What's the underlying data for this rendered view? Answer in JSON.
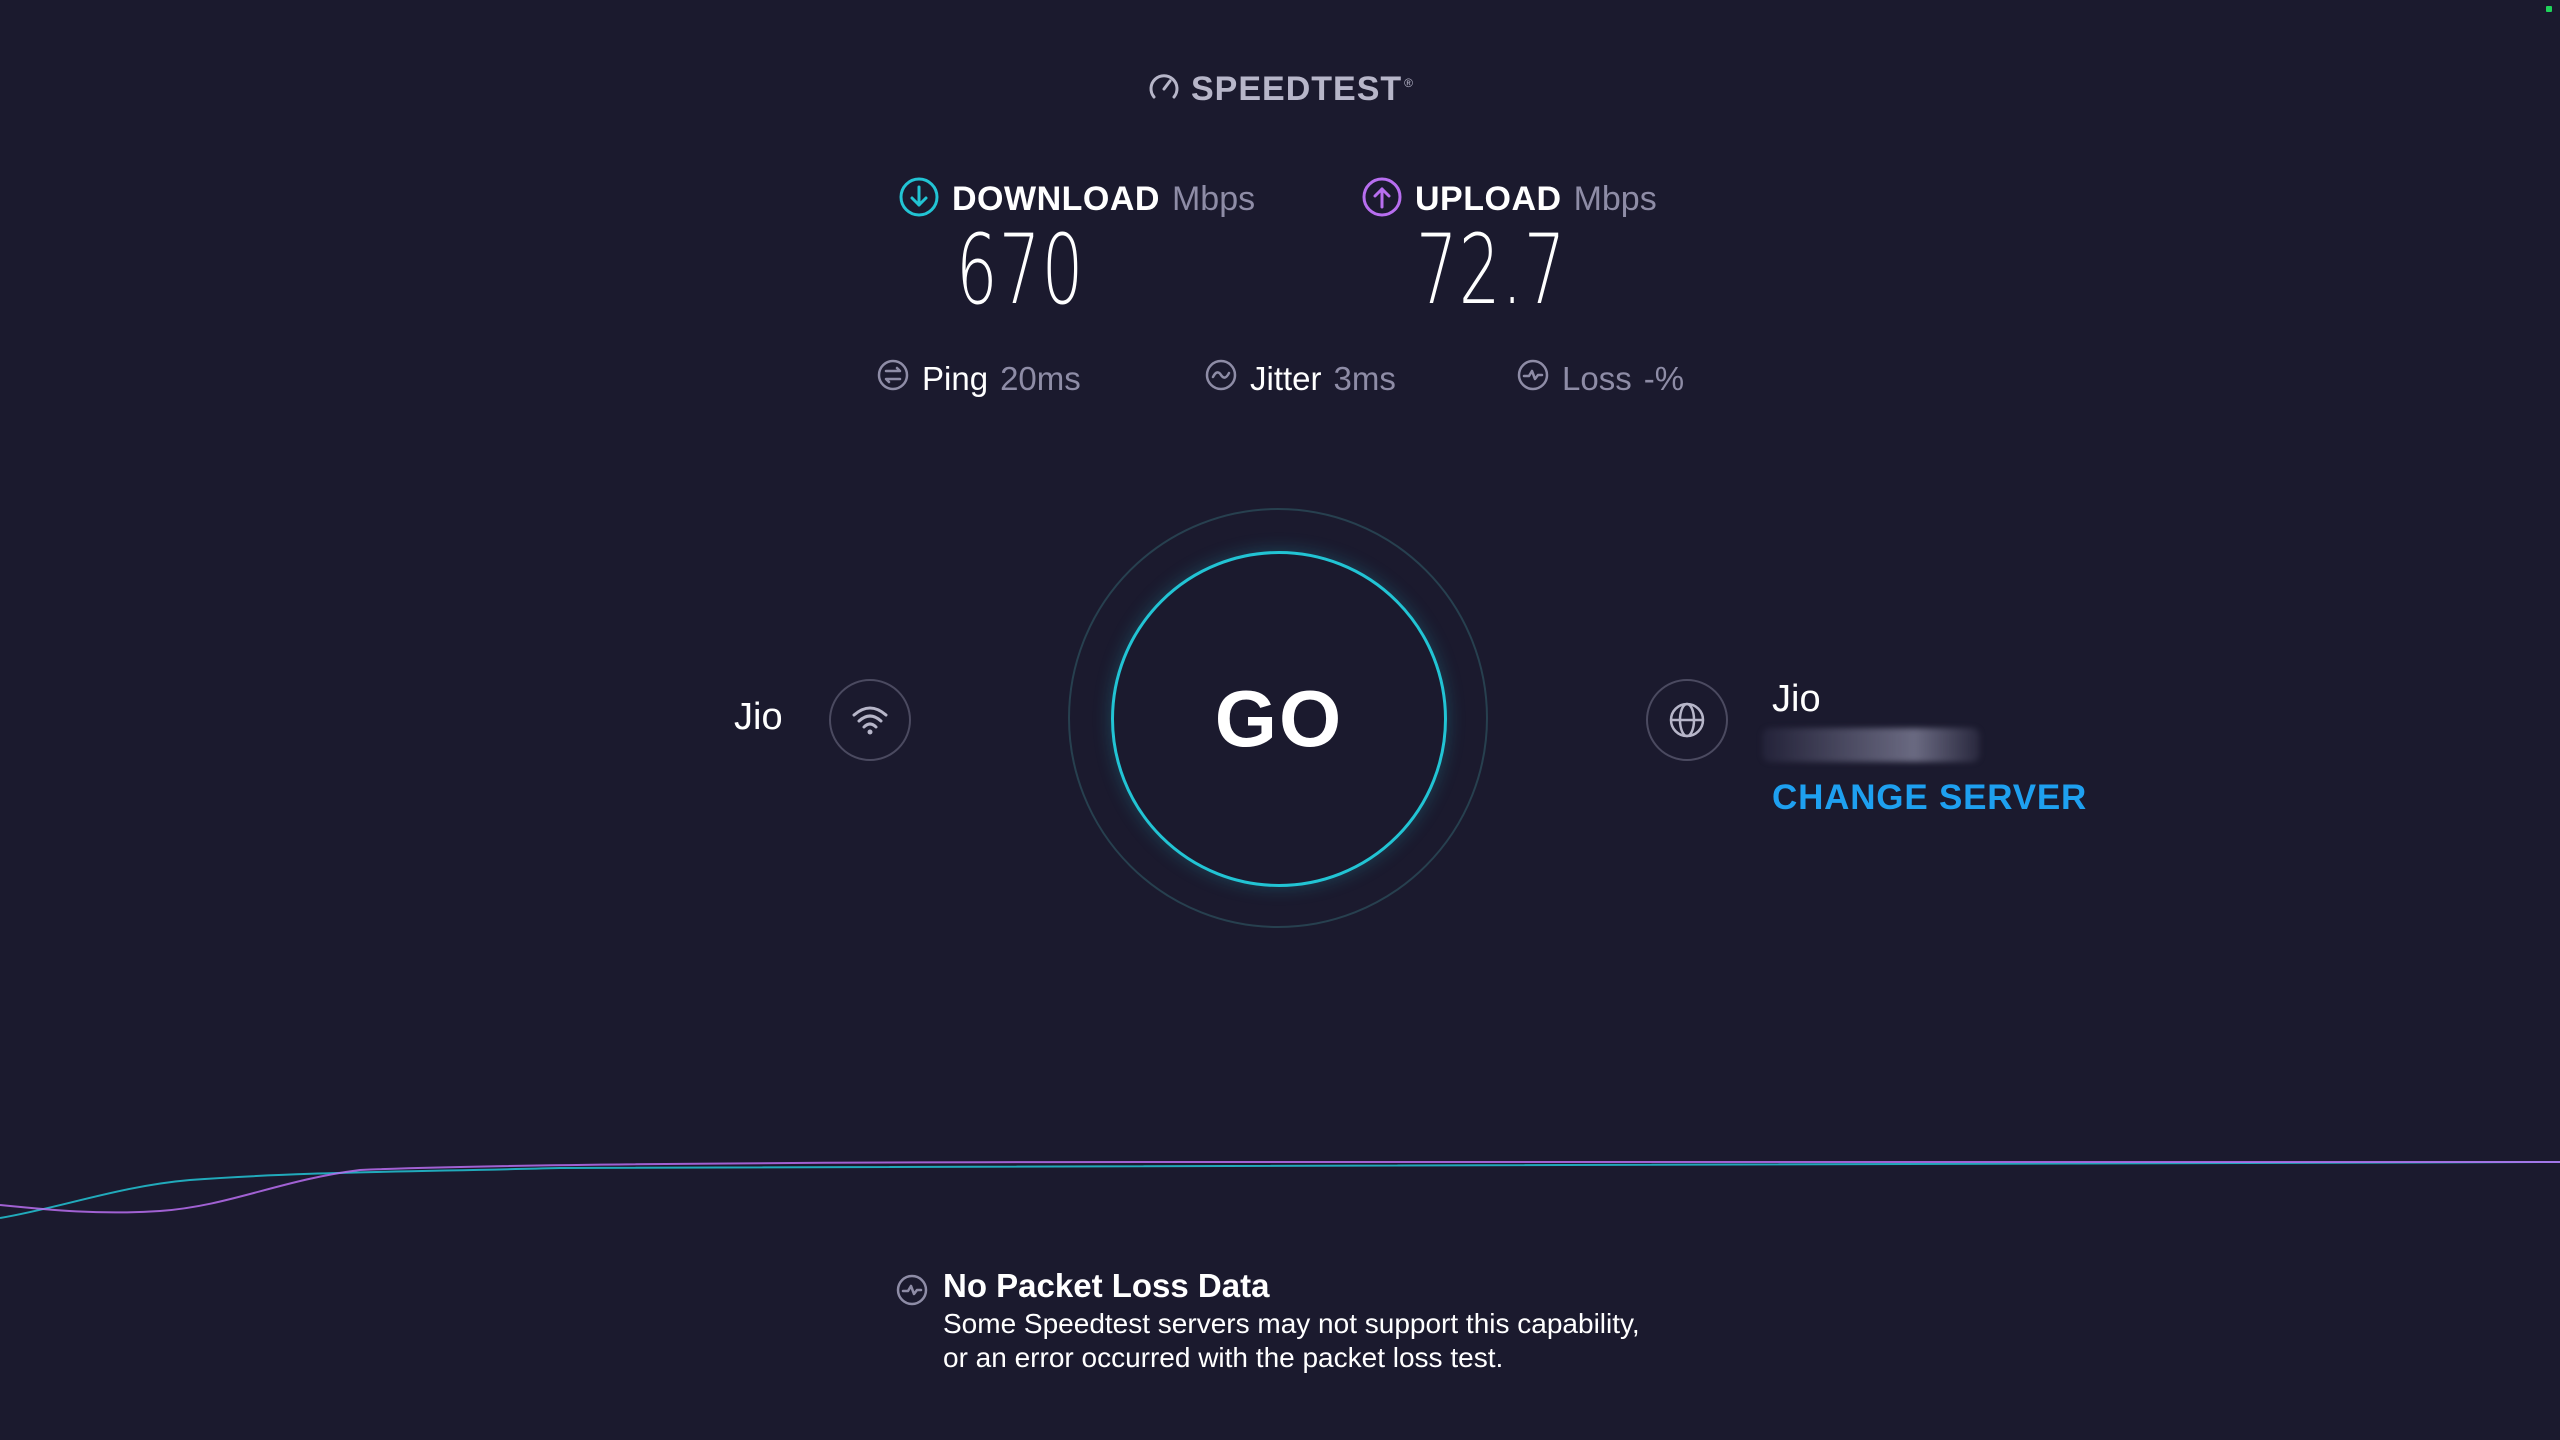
{
  "brand": {
    "name": "SPEEDTEST",
    "trademark": "®",
    "icon": "speedometer-icon"
  },
  "download": {
    "label": "DOWNLOAD",
    "unit": "Mbps",
    "value": "670",
    "icon": "download-arrow-icon",
    "color": "#22c4d4"
  },
  "upload": {
    "label": "UPLOAD",
    "unit": "Mbps",
    "value": "72.7",
    "icon": "upload-arrow-icon",
    "color": "#b86ef0"
  },
  "stats": {
    "ping": {
      "label": "Ping",
      "value": "20ms",
      "icon": "ping-icon"
    },
    "jitter": {
      "label": "Jitter",
      "value": "3ms",
      "icon": "jitter-icon"
    },
    "loss": {
      "label": "Loss",
      "value": "-%",
      "icon": "loss-icon"
    }
  },
  "go_button": {
    "label": "GO"
  },
  "isp": {
    "name": "Jio",
    "icon": "wifi-icon"
  },
  "server": {
    "name": "Jio",
    "location": "",
    "change_label": "CHANGE SERVER",
    "icon": "globe-icon"
  },
  "notice": {
    "title": "No Packet Loss Data",
    "line1": "Some Speedtest servers may not support this capability,",
    "line2": "or an error occurred with the packet loss test.",
    "icon": "loss-icon"
  },
  "colors": {
    "background": "#1b1a2e",
    "accent_cyan": "#22c4d4",
    "accent_purple": "#b86ef0",
    "link_blue": "#1ea0f0"
  }
}
